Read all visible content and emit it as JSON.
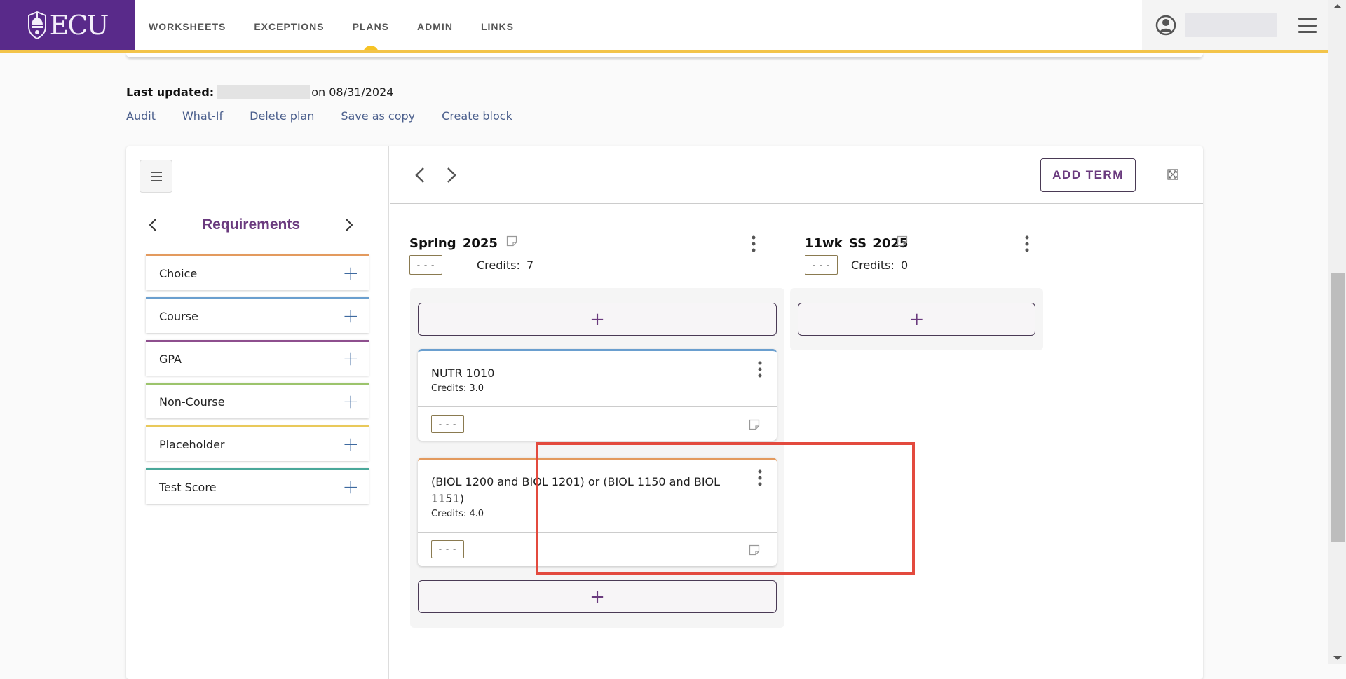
{
  "header": {
    "logo_text": "ECU",
    "nav": [
      {
        "label": "WORKSHEETS",
        "active": false
      },
      {
        "label": "EXCEPTIONS",
        "active": false
      },
      {
        "label": "PLANS",
        "active": true
      },
      {
        "label": "ADMIN",
        "active": false
      },
      {
        "label": "LINKS",
        "active": false
      }
    ],
    "user_icon": "user-circle-icon",
    "menu_icon": "hamburger-icon",
    "accent_color": "#f3c44a",
    "brand_color": "#592a8a"
  },
  "info": {
    "last_updated_label": "Last updated:",
    "last_updated_date": "on 08/31/2024",
    "actions": [
      "Audit",
      "What-If",
      "Delete plan",
      "Save as copy",
      "Create block"
    ]
  },
  "sidebar": {
    "title": "Requirements",
    "items": [
      {
        "label": "Choice",
        "color": "#e39a5e"
      },
      {
        "label": "Course",
        "color": "#6a9fcf"
      },
      {
        "label": "GPA",
        "color": "#8e4f8e"
      },
      {
        "label": "Non-Course",
        "color": "#9cc46c"
      },
      {
        "label": "Placeholder",
        "color": "#e9c95a"
      },
      {
        "label": "Test Score",
        "color": "#4aa89a"
      }
    ]
  },
  "plan": {
    "add_term_label": "ADD TERM",
    "terms": [
      {
        "title": "Spring 2025",
        "grade": "- - -",
        "credits_label": "Credits:",
        "credits": "7",
        "courses": [
          {
            "name": "NUTR 1010",
            "credits": "Credits: 3.0",
            "grade": "- - -",
            "color": "#6a9fcf"
          },
          {
            "name": "(BIOL 1200 and BIOL 1201) or (BIOL 1150 and BIOL 1151)",
            "credits": "Credits: 4.0",
            "grade": "- - -",
            "color": "#e39a5e",
            "highlighted": true
          }
        ]
      },
      {
        "title": "11wk SS 2025",
        "grade": "- - -",
        "credits_label": "Credits:",
        "credits": "0",
        "courses": []
      }
    ],
    "add_symbol": "+"
  }
}
